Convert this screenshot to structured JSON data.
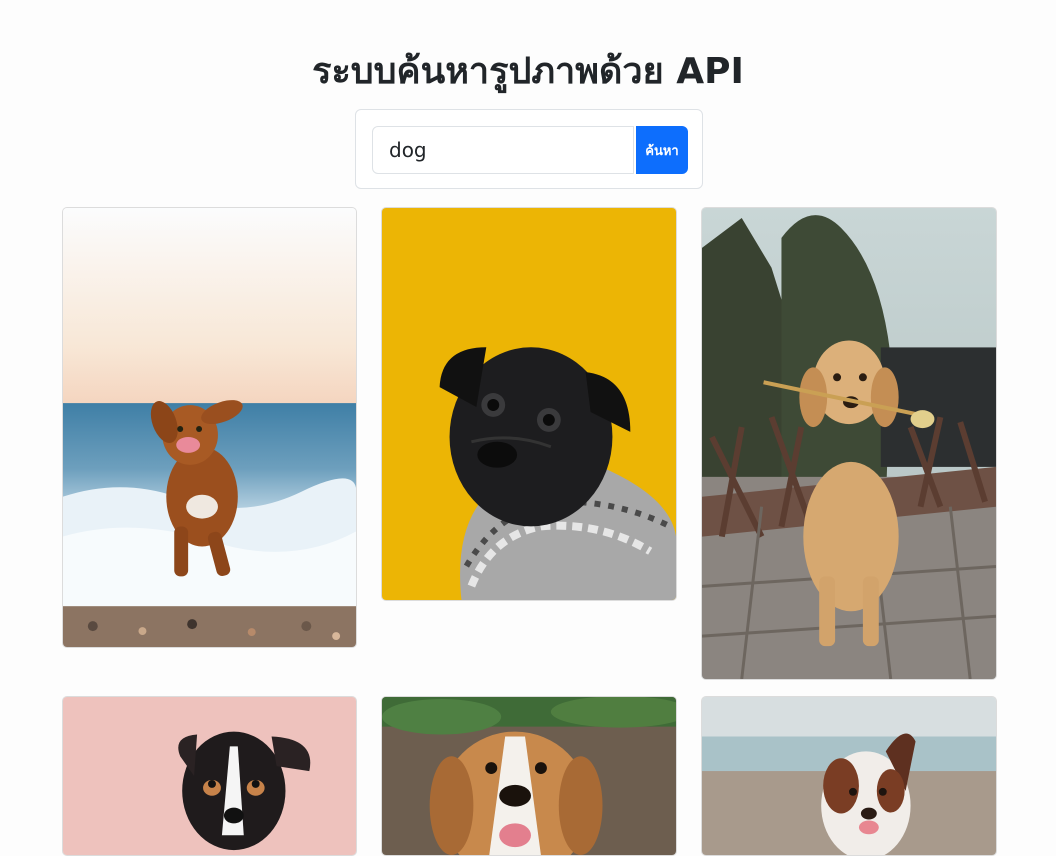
{
  "page": {
    "title": "ระบบค้นหารูปภาพด้วย API"
  },
  "search": {
    "value": "dog",
    "button_label": "ค้นหา"
  },
  "results": [
    {
      "subject": "dog running on beach"
    },
    {
      "subject": "black pug in sweater"
    },
    {
      "subject": "golden retriever puppy with flower"
    },
    {
      "subject": "terrier on pink background"
    },
    {
      "subject": "beagle"
    },
    {
      "subject": "australian shepherd"
    }
  ],
  "colors": {
    "accent": "#0d6efd",
    "pug_background": "#ecb505"
  }
}
